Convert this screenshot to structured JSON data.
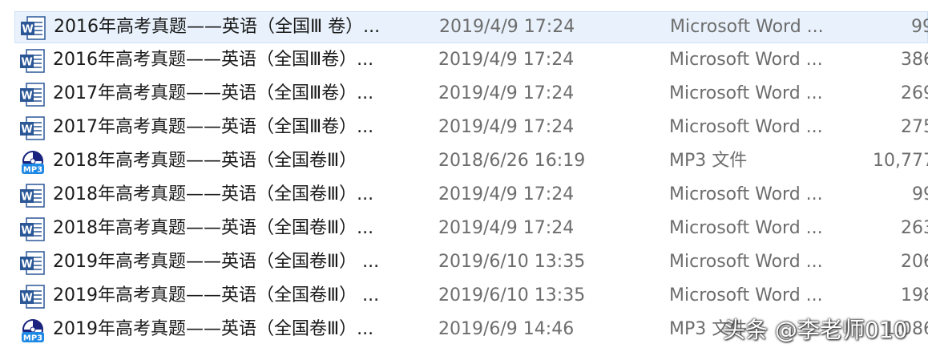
{
  "files": [
    {
      "name": "2016年高考真题——英语（全国Ⅲ 卷）...",
      "date": "2019/4/9 17:24",
      "type": "Microsoft Word ...",
      "size": "99",
      "icon": "word-doc-icon"
    },
    {
      "name": "2016年高考真题——英语（全国Ⅲ卷）...",
      "date": "2019/4/9 17:24",
      "type": "Microsoft Word ...",
      "size": "386",
      "icon": "word-doc-icon"
    },
    {
      "name": "2017年高考真题——英语（全国Ⅲ卷）...",
      "date": "2019/4/9 17:24",
      "type": "Microsoft Word ...",
      "size": "269",
      "icon": "word-doc-icon"
    },
    {
      "name": "2017年高考真题——英语（全国Ⅲ卷）...",
      "date": "2019/4/9 17:24",
      "type": "Microsoft Word ...",
      "size": "275",
      "icon": "word-doc-icon"
    },
    {
      "name": "2018年高考真题——英语（全国卷Ⅲ）",
      "date": "2018/6/26 16:19",
      "type": "MP3 文件",
      "size": "10,777",
      "icon": "mp3-file-icon"
    },
    {
      "name": "2018年高考真题——英语（全国卷Ⅲ）...",
      "date": "2019/4/9 17:24",
      "type": "Microsoft Word ...",
      "size": "99",
      "icon": "word-doc-icon"
    },
    {
      "name": "2018年高考真题——英语（全国卷Ⅲ）...",
      "date": "2019/4/9 17:24",
      "type": "Microsoft Word ...",
      "size": "263",
      "icon": "word-doc-icon"
    },
    {
      "name": "2019年高考真题——英语（全国卷Ⅲ） ...",
      "date": "2019/6/10 13:35",
      "type": "Microsoft Word ...",
      "size": "206",
      "icon": "word-doc-icon"
    },
    {
      "name": "2019年高考真题——英语（全国卷Ⅲ） ...",
      "date": "2019/6/10 13:35",
      "type": "Microsoft Word ...",
      "size": "198",
      "icon": "word-doc-icon"
    },
    {
      "name": "2019年高考真题——英语（全国卷Ⅲ）...",
      "date": "2019/6/9 14:46",
      "type": "MP3 文件",
      "size": "1,086",
      "icon": "mp3-file-icon"
    }
  ],
  "watermark": "头条 @李老师010",
  "colors": {
    "selected_row": "#e9f2fc",
    "word_blue": "#2b5797",
    "mp3_blue": "#1e88e5",
    "name_text": "#1a1a1a",
    "meta_text": "#6d6d6d"
  }
}
